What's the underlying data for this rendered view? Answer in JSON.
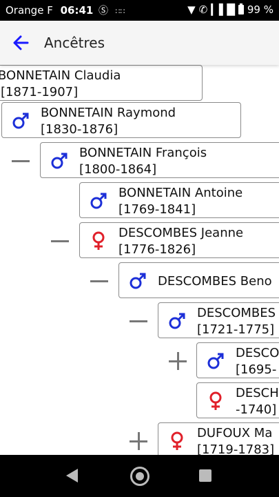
{
  "status_bar": {
    "carrier": "Orange F",
    "time": "06:41",
    "battery": "99 %"
  },
  "app_bar": {
    "title": "Ancêtres"
  },
  "colors": {
    "male": "#1c2fd8",
    "female": "#e0202a",
    "accent": "#1a1aff"
  },
  "tree": {
    "nodes": [
      {
        "name": "BONNETAIN Claudia",
        "years": "[1871-1907]",
        "gender": "none"
      },
      {
        "name": "BONNETAIN Raymond",
        "years": "[1830-1876]",
        "gender": "male"
      },
      {
        "name": "BONNETAIN François",
        "years": "[1800-1864]",
        "gender": "male",
        "toggle": "collapse"
      },
      {
        "name": "BONNETAIN Antoine",
        "years": "[1769-1841]",
        "gender": "male"
      },
      {
        "name": "DESCOMBES Jeanne",
        "years": "[1776-1826]",
        "gender": "female",
        "toggle": "collapse"
      },
      {
        "name": "DESCOMBES Beno",
        "years": "",
        "gender": "male",
        "toggle": "collapse"
      },
      {
        "name": "DESCOMBES",
        "years": "[1721-1775]",
        "gender": "male",
        "toggle": "collapse"
      },
      {
        "name": "DESCO",
        "years": "[1695-",
        "gender": "male",
        "toggle": "expand"
      },
      {
        "name": "DESCH",
        "years": "-1740]",
        "gender": "female"
      },
      {
        "name": "DUFOUX Ma",
        "years": "[1719-1783]",
        "gender": "female",
        "toggle": "expand"
      }
    ]
  }
}
